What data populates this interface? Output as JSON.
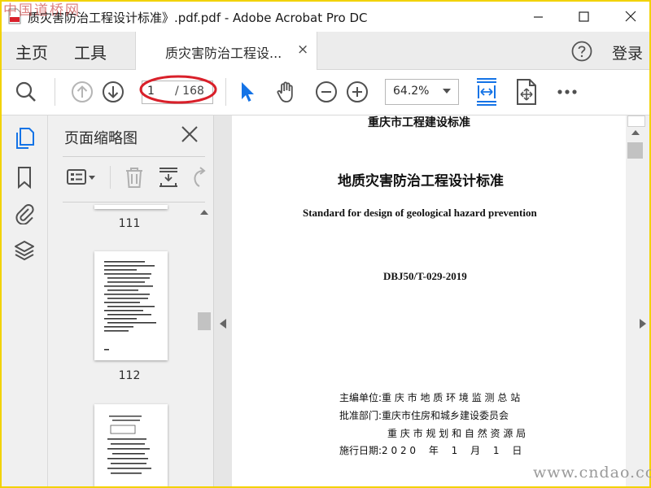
{
  "window": {
    "title": "质灾害防治工程设计标准》.pdf.pdf - Adobe Acrobat Pro DC"
  },
  "nav": {
    "home": "主页",
    "tools": "工具",
    "tab_label": "质灾害防治工程设...",
    "tab_close": "×",
    "login": "登录"
  },
  "toolbar": {
    "page_current": "1",
    "page_total": "/ 168",
    "zoom": "64.2%"
  },
  "panel": {
    "title": "页面缩略图",
    "thumbnails": [
      {
        "page": "111"
      },
      {
        "page": "112"
      }
    ]
  },
  "document": {
    "header": "重庆市工程建设标准",
    "title_cn": "地质灾害防治工程设计标准",
    "title_en": "Standard for design of geological hazard prevention",
    "code": "DBJ50/T-029-2019",
    "editor": "主编单位:重 庆 市 地 质 环 境 监 测 总 站",
    "approver": "批准部门:重庆市住房和城乡建设委员会",
    "approver2": "重 庆 市 规 划 和 自 然 资 源 局",
    "effective": "施行日期:2 0 2 0 　年　 1 　月　 1 　日"
  },
  "watermarks": {
    "top_left": "中国道桥网",
    "bottom_right": "www.cndao.com"
  },
  "colors": {
    "accent_blue": "#1473e6",
    "highlight_red": "#d9202a",
    "frame_yellow": "#f2d200"
  }
}
